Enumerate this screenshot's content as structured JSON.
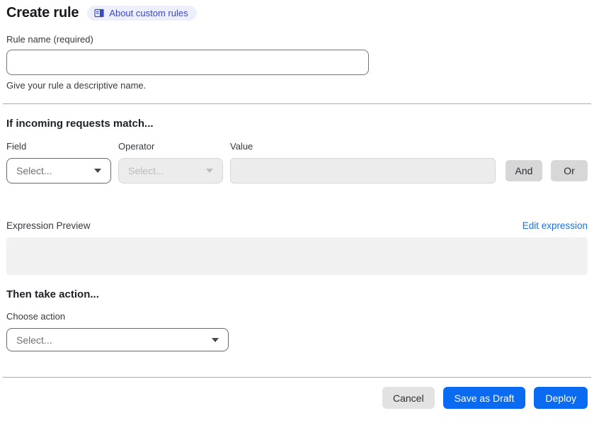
{
  "page": {
    "title": "Create rule"
  },
  "about": {
    "label": "About custom rules"
  },
  "rule_name": {
    "label": "Rule name (required)",
    "value": "",
    "helper": "Give your rule a descriptive name."
  },
  "match": {
    "heading": "If incoming requests match...",
    "field_label": "Field",
    "operator_label": "Operator",
    "value_label": "Value",
    "field_placeholder": "Select...",
    "operator_placeholder": "Select...",
    "value_text": "",
    "and_label": "And",
    "or_label": "Or"
  },
  "expression": {
    "label": "Expression Preview",
    "edit_link": "Edit expression",
    "preview": ""
  },
  "action": {
    "heading": "Then take action...",
    "label": "Choose action",
    "placeholder": "Select..."
  },
  "footer": {
    "cancel": "Cancel",
    "save_draft": "Save as Draft",
    "deploy": "Deploy"
  },
  "colors": {
    "primary_blue": "#0b6bf0",
    "link_blue": "#1d6fe0",
    "badge_bg": "#edeffb",
    "badge_text": "#3b49c0",
    "disabled_bg": "#ececec",
    "preview_bg": "#f1f1f1"
  }
}
